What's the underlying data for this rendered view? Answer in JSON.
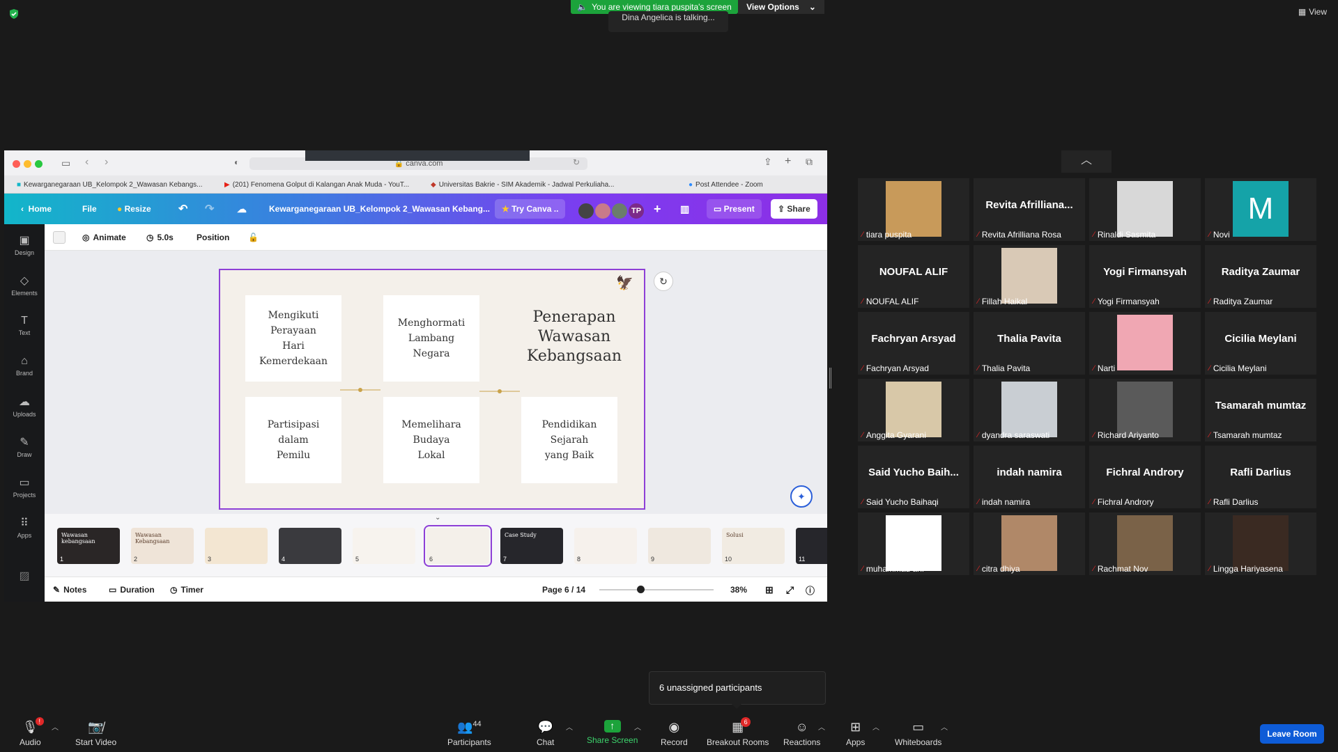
{
  "meeting": {
    "viewing_banner": "You are viewing tiara puspita's screen",
    "view_options": "View Options",
    "talking": "Dina Angelica is talking...",
    "view_label": "View"
  },
  "browser": {
    "url": "canva.com",
    "tabs": [
      "Kewarganegaraan UB_Kelompok 2_Wawasan Kebangs...",
      "(201) Fenomena Golput di Kalangan Anak Muda - YouT...",
      "Universitas Bakrie - SIM Akademik - Jadwal Perkuliaha...",
      "Post Attendee - Zoom"
    ]
  },
  "canva": {
    "home": "Home",
    "file": "File",
    "resize": "Resize",
    "doc_title": "Kewarganegaraan UB_Kelompok 2_Wawasan Kebang...",
    "try_canva": "Try Canva ..",
    "avatar_initials": "TP",
    "present": "Present",
    "share": "Share",
    "animate": "Animate",
    "duration": "5.0s",
    "position": "Position",
    "sidebar": [
      "Design",
      "Elements",
      "Text",
      "Brand",
      "Uploads",
      "Draw",
      "Projects",
      "Apps"
    ],
    "slide": {
      "title": "Penerapan\nWawasan\nKebangsaan",
      "cards": [
        "Mengikuti\nPerayaan\nHari\nKemerdekaan",
        "Menghormati\nLambang\nNegara",
        "Partisipasi\ndalam\nPemilu",
        "Memelihara\nBudaya\nLokal",
        "Pendidikan\nSejarah\nyang Baik"
      ]
    },
    "thumbs": [
      {
        "num": "1",
        "label": "Wawasan kebangsaan",
        "bg": "#2a2626"
      },
      {
        "num": "2",
        "label": "Wawasan Kebangsaan",
        "bg": "#efe4d8"
      },
      {
        "num": "3",
        "label": "",
        "bg": "#f3e6d2"
      },
      {
        "num": "4",
        "label": "",
        "bg": "#3a3a3e"
      },
      {
        "num": "5",
        "label": "",
        "bg": "#f7f3ee"
      },
      {
        "num": "6",
        "label": "",
        "bg": "#f4f0ea"
      },
      {
        "num": "7",
        "label": "Case Study",
        "bg": "#26262b"
      },
      {
        "num": "8",
        "label": "",
        "bg": "#f6f1ec"
      },
      {
        "num": "9",
        "label": "",
        "bg": "#efe8df"
      },
      {
        "num": "10",
        "label": "Solusi",
        "bg": "#f1ebe2"
      },
      {
        "num": "11",
        "label": "",
        "bg": "#26262b"
      }
    ],
    "notes": "Notes",
    "duration_btn": "Duration",
    "timer": "Timer",
    "page": "Page 6 / 14",
    "zoom": "38%"
  },
  "participants": [
    {
      "name": "tiara puspita",
      "big": "",
      "photo": "#c89a5a"
    },
    {
      "name": "Revita Afrilliana Rosa",
      "big": "Revita Afrilliana...",
      "photo": ""
    },
    {
      "name": "Rinaldi Sasmita",
      "big": "",
      "photo": "#d8d8d8"
    },
    {
      "name": "Novi",
      "big": "",
      "photo": "#15a3a8",
      "letter": "M"
    },
    {
      "name": "NOUFAL ALIF",
      "big": "NOUFAL ALIF",
      "photo": ""
    },
    {
      "name": "Fillah Haikal",
      "big": "",
      "photo": "#d9c9b6"
    },
    {
      "name": "Yogi Firmansyah",
      "big": "Yogi Firmansyah",
      "photo": ""
    },
    {
      "name": "Raditya Zaumar",
      "big": "Raditya Zaumar",
      "photo": ""
    },
    {
      "name": "Fachryan Arsyad",
      "big": "Fachryan Arsyad",
      "photo": ""
    },
    {
      "name": "Thalia Pavita",
      "big": "Thalia Pavita",
      "photo": ""
    },
    {
      "name": "Narti",
      "big": "",
      "photo": "#f0a7b3"
    },
    {
      "name": "Cicilia Meylani",
      "big": "Cicilia Meylani",
      "photo": ""
    },
    {
      "name": "Anggita Gyarani",
      "big": "",
      "photo": "#d8c8a8"
    },
    {
      "name": "dyandra saraswati",
      "big": "",
      "photo": "#c9ced3"
    },
    {
      "name": "Richard Ariyanto",
      "big": "",
      "photo": "#5a5a5a"
    },
    {
      "name": "Tsamarah mumtaz",
      "big": "Tsamarah mumtaz",
      "photo": ""
    },
    {
      "name": "Said Yucho Baihaqi",
      "big": "Said Yucho Baih...",
      "photo": ""
    },
    {
      "name": "indah namira",
      "big": "indah namira",
      "photo": ""
    },
    {
      "name": "Fichral Androry",
      "big": "Fichral Androry",
      "photo": ""
    },
    {
      "name": "Rafli Darlius",
      "big": "Rafli Darlius",
      "photo": ""
    },
    {
      "name": "muhammad arif",
      "big": "",
      "photo": "#ffffff"
    },
    {
      "name": "citra dhiya",
      "big": "",
      "photo": "#b08868"
    },
    {
      "name": "Rachmat Nov",
      "big": "",
      "photo": "#7a6248"
    },
    {
      "name": "Lingga Hariyasena",
      "big": "",
      "photo": "#3a2a22"
    }
  ],
  "popup": "6 unassigned participants",
  "bar": {
    "audio": "Audio",
    "audio_badge": "!",
    "start_video": "Start Video",
    "participants": "Participants",
    "participants_count": "44",
    "chat": "Chat",
    "share_screen": "Share Screen",
    "record": "Record",
    "breakout": "Breakout Rooms",
    "breakout_badge": "6",
    "reactions": "Reactions",
    "apps": "Apps",
    "whiteboards": "Whiteboards",
    "leave": "Leave Room"
  }
}
